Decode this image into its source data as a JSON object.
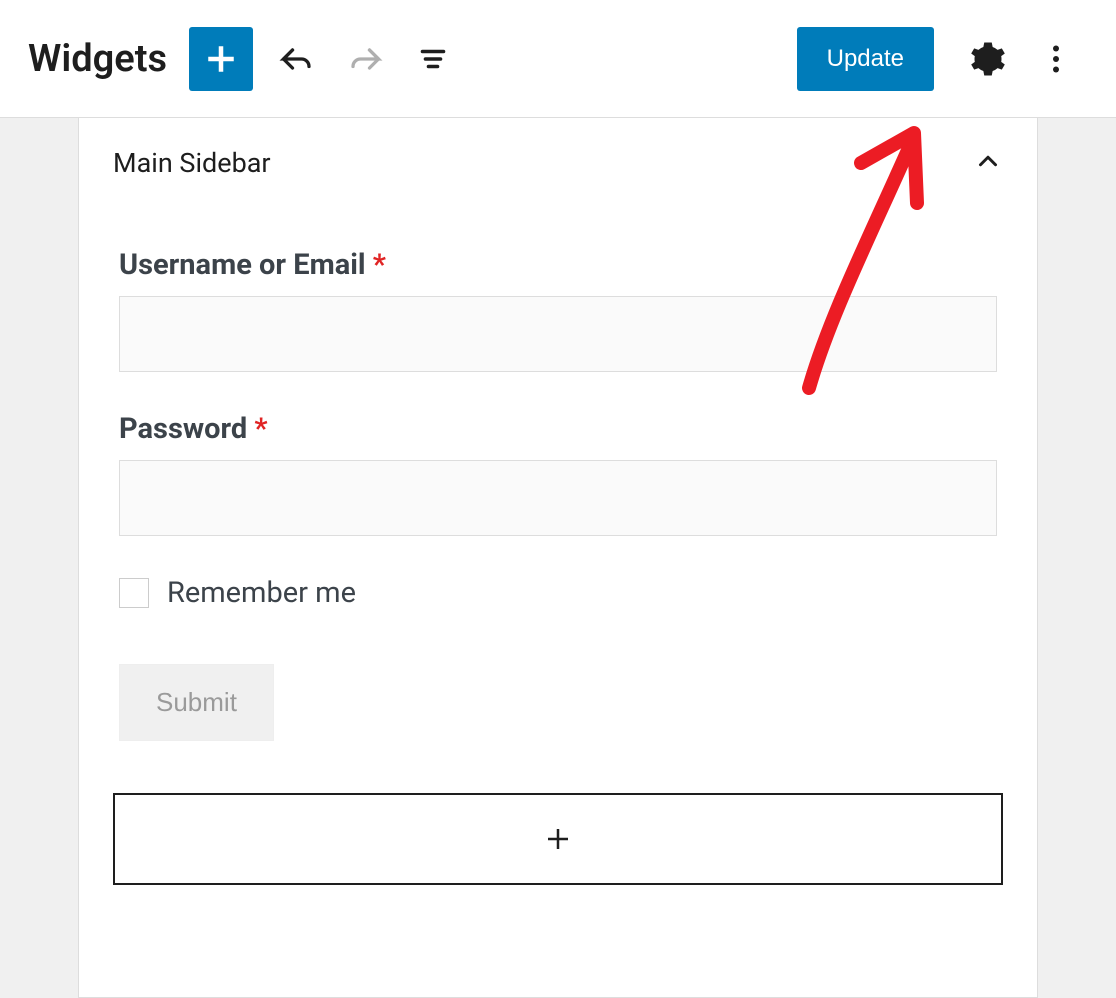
{
  "toolbar": {
    "title": "Widgets",
    "update_label": "Update"
  },
  "panel": {
    "title": "Main Sidebar"
  },
  "form": {
    "username_label": "Username or Email",
    "password_label": "Password",
    "required_mark": "*",
    "remember_label": "Remember me",
    "submit_label": "Submit"
  },
  "colors": {
    "primary": "#007cba",
    "required": "#e02424"
  }
}
